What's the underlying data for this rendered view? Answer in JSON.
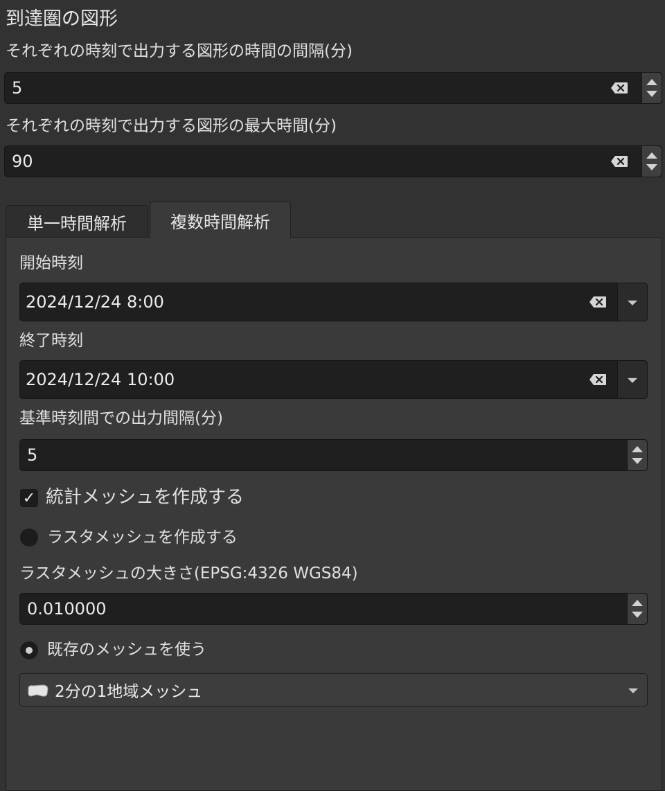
{
  "section_title": "到達圏の図形",
  "interval": {
    "label": "それぞれの時刻で出力する図形の時間の間隔(分)",
    "value": "5"
  },
  "max_time": {
    "label": "それぞれの時刻で出力する図形の最大時間(分)",
    "value": "90"
  },
  "tabs": [
    {
      "label": "単一時間解析",
      "active": false
    },
    {
      "label": "複数時間解析",
      "active": true
    }
  ],
  "multi": {
    "start_label": "開始時刻",
    "start_value": "2024/12/24 8:00",
    "end_label": "終了時刻",
    "end_value": "2024/12/24 10:00",
    "output_interval_label": "基準時刻間での出力間隔(分)",
    "output_interval_value": "5",
    "stat_mesh_checkbox_mark": "✓",
    "stat_mesh_label": "統計メッシュを作成する",
    "stat_mesh_checked": true,
    "raster_mesh_label": "ラスタメッシュを作成する",
    "raster_mesh_selected": false,
    "raster_size_label": "ラスタメッシュの大きさ(EPSG:4326 WGS84)",
    "raster_size_value": "0.010000",
    "existing_mesh_label": "既存のメッシュを使う",
    "existing_mesh_selected": true,
    "mesh_layer_value": "2分の1地域メッシュ",
    "mesh_layer_icon": "polygon-layer-icon"
  },
  "colors": {
    "background": "#323232",
    "field": "#1f1f1f",
    "text": "#e2e2e2"
  }
}
